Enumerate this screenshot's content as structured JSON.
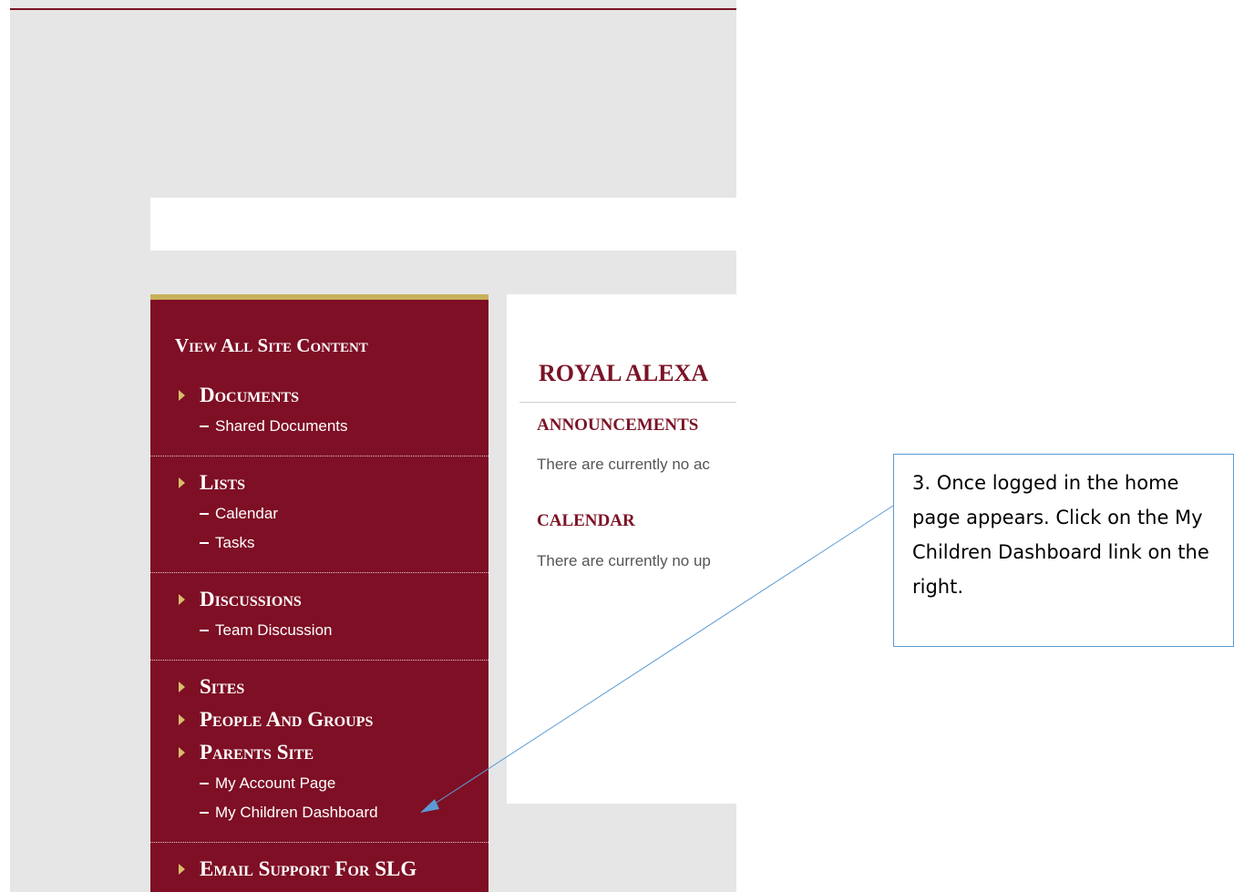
{
  "sidebar": {
    "view_all": "View All Site Content",
    "groups": [
      {
        "heading": "Documents",
        "items": [
          "Shared Documents"
        ]
      },
      {
        "heading": "Lists",
        "items": [
          "Calendar",
          "Tasks"
        ]
      },
      {
        "heading": "Discussions",
        "items": [
          "Team Discussion"
        ]
      },
      {
        "heading": "Sites",
        "items": []
      },
      {
        "heading": "People And Groups",
        "items": []
      },
      {
        "heading": "Parents Site",
        "items": [
          "My Account Page",
          "My Children Dashboard"
        ]
      },
      {
        "heading": "Email Support For SLG",
        "items": []
      }
    ]
  },
  "main": {
    "site_title": "ROYAL ALEXA",
    "announcements": {
      "title": "ANNOUNCEMENTS",
      "text": "There are currently no ac"
    },
    "calendar": {
      "title": "CALENDAR",
      "text": "There are currently no up"
    }
  },
  "callout": {
    "text": "3. Once logged in the home page appears. Click on the My Children Dashboard link on the right."
  },
  "colors": {
    "sidebar_bg": "#7e0f25",
    "sidebar_accent": "#c8b15a",
    "heading_text": "#7b1326",
    "callout_border": "#5b9bd5"
  }
}
